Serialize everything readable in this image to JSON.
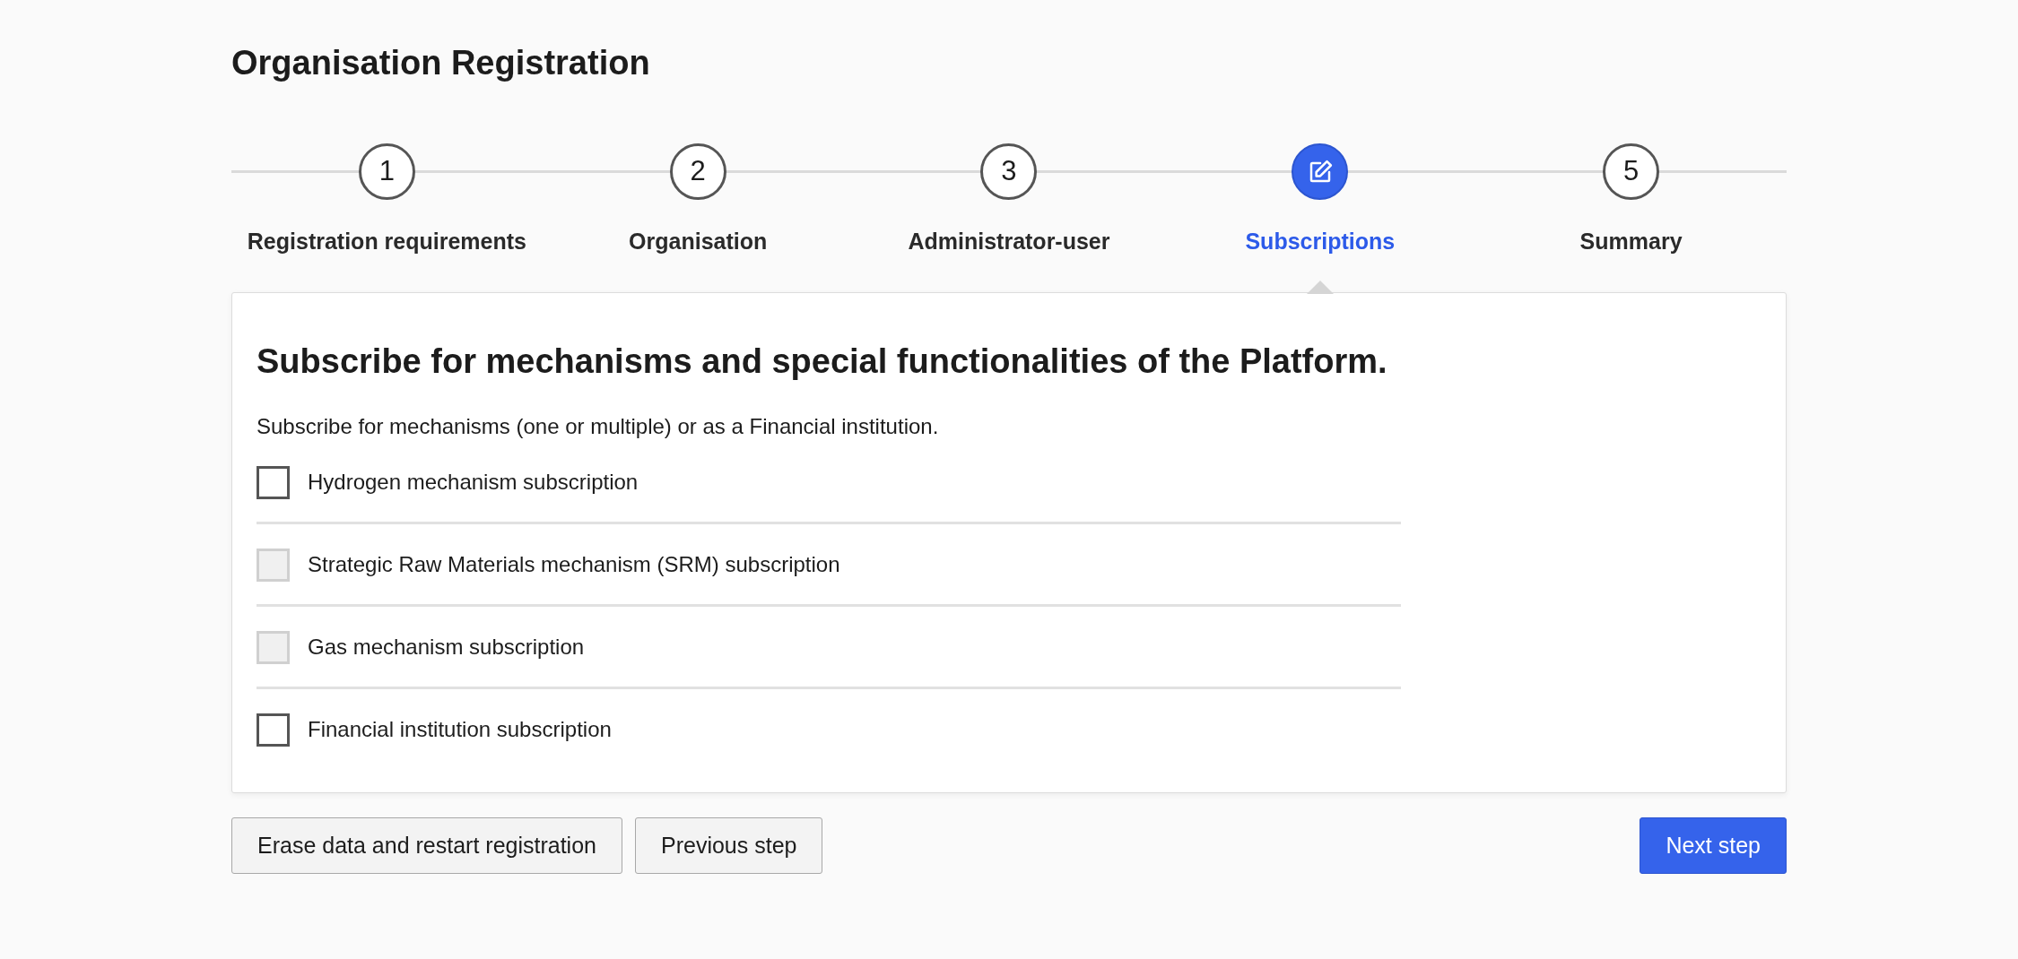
{
  "page": {
    "title": "Organisation Registration"
  },
  "steps": [
    {
      "number": "1",
      "label": "Registration requirements",
      "selected": false
    },
    {
      "number": "2",
      "label": "Organisation",
      "selected": false
    },
    {
      "number": "3",
      "label": "Administrator-user",
      "selected": false
    },
    {
      "label": "Subscriptions",
      "selected": true
    },
    {
      "number": "5",
      "label": "Summary",
      "selected": false
    }
  ],
  "card": {
    "heading": "Subscribe for mechanisms and special functionalities of the Platform.",
    "description": "Subscribe for mechanisms (one or multiple) or as a Financial institution.",
    "options": [
      {
        "label": "Hydrogen mechanism subscription",
        "checked": false,
        "disabled": false
      },
      {
        "label": "Strategic Raw Materials mechanism (SRM) subscription",
        "checked": false,
        "disabled": true
      },
      {
        "label": "Gas mechanism subscription",
        "checked": false,
        "disabled": true
      },
      {
        "label": "Financial institution subscription",
        "checked": false,
        "disabled": false
      }
    ]
  },
  "buttons": [
    {
      "label": "Erase data and restart registration",
      "kind": "secondary"
    },
    {
      "label": "Previous step",
      "kind": "secondary"
    },
    {
      "label": "Next step",
      "kind": "primary"
    }
  ]
}
